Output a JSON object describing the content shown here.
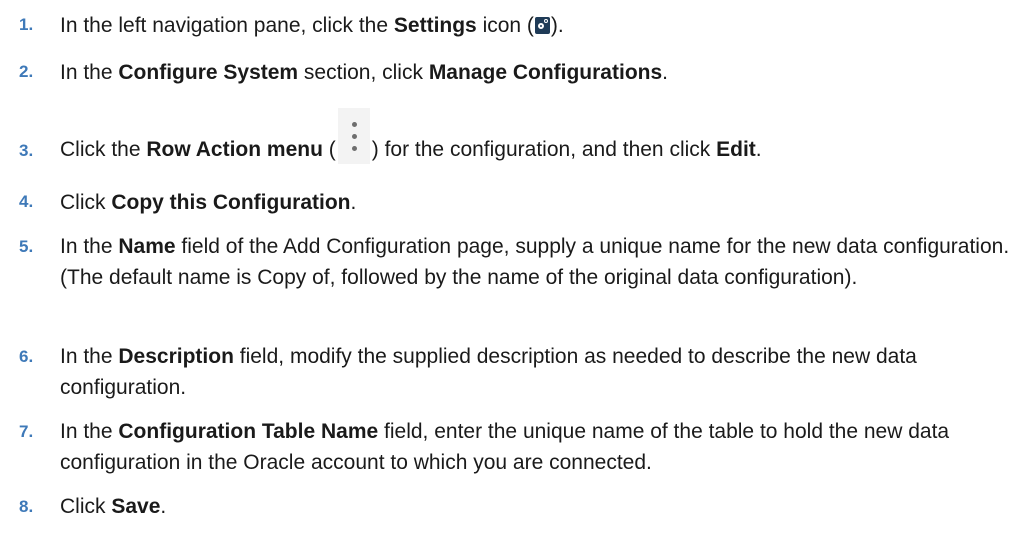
{
  "steps": [
    {
      "num": "1.",
      "parts": [
        "In the left navigation pane, click the ",
        "Settings",
        " icon (",
        ")."
      ]
    },
    {
      "num": "2.",
      "parts": [
        "In the ",
        "Configure System",
        " section, click ",
        "Manage Configurations",
        "."
      ]
    },
    {
      "num": "3.",
      "parts": [
        "Click the ",
        "Row Action menu",
        " (",
        ") for the configuration, and then click ",
        "Edit",
        "."
      ]
    },
    {
      "num": "4.",
      "parts": [
        "Click ",
        "Copy this Configuration",
        "."
      ]
    },
    {
      "num": "5.",
      "parts": [
        "In the ",
        "Name",
        " field of the Add Configuration page, supply a unique name for the new data configuration. (The default name is Copy of, followed by the name of the original data configuration)."
      ]
    },
    {
      "num": "6.",
      "parts": [
        "In the ",
        "Description",
        " field, modify the supplied description as needed to describe the new data configuration."
      ]
    },
    {
      "num": "7.",
      "parts": [
        "In the ",
        "Configuration Table Name",
        " field, enter the unique name of the table to hold the new data configuration in the Oracle account to which you are connected."
      ]
    },
    {
      "num": "8.",
      "parts": [
        "Click ",
        "Save",
        "."
      ]
    }
  ],
  "icons": {
    "settings": "gear-icon",
    "row_action": "kebab-icon"
  },
  "colors": {
    "step_number": "#3e79b8",
    "text": "#1a1a1a",
    "settings_icon_bg": "#1f3b57"
  }
}
